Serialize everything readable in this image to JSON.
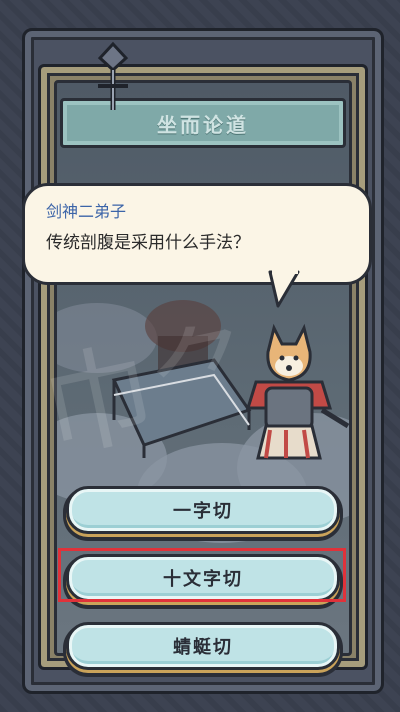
{
  "header": {
    "title": "坐而论道"
  },
  "dialog": {
    "speaker": "剑神二弟子",
    "question": "传统剖腹是采用什么手法？"
  },
  "answers": [
    {
      "label": "一字切"
    },
    {
      "label": "十文字切",
      "highlighted": true
    },
    {
      "label": "蜻蜓切"
    }
  ],
  "colors": {
    "highlight": "#e0323a",
    "speaker_text": "#3b64a8",
    "answer_button": "#bfe3e6",
    "title_bar": "#7fa9a8"
  }
}
